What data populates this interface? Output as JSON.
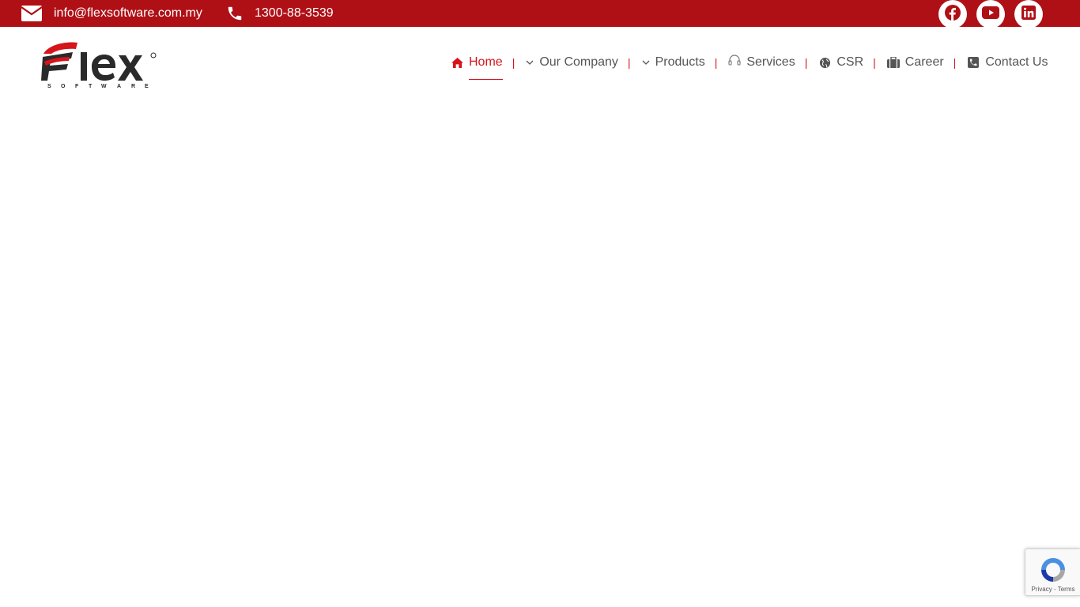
{
  "topbar": {
    "email": "info@flexsoftware.com.my",
    "phone": "1300-88-3539",
    "background": "#af1016",
    "social": [
      {
        "name": "facebook-icon"
      },
      {
        "name": "youtube-icon"
      },
      {
        "name": "linkedin-icon"
      }
    ]
  },
  "header": {
    "logo_text": "Flex",
    "logo_subtext": "SOFTWARE"
  },
  "nav": {
    "accent": "#d6141c",
    "separator": "|",
    "items": [
      {
        "label": "Home",
        "icon": "home-icon",
        "active": true
      },
      {
        "label": "Our Company",
        "icon": "chevron-down-icon",
        "active": false
      },
      {
        "label": "Products",
        "icon": "chevron-down-icon",
        "active": false
      },
      {
        "label": "Services",
        "icon": "headset-icon",
        "active": false
      },
      {
        "label": "CSR",
        "icon": "globe-icon",
        "active": false
      },
      {
        "label": "Career",
        "icon": "briefcase-icon",
        "active": false
      },
      {
        "label": "Contact Us",
        "icon": "phone-square-icon",
        "active": false
      }
    ]
  },
  "recaptcha": {
    "links": "Privacy - Terms"
  }
}
